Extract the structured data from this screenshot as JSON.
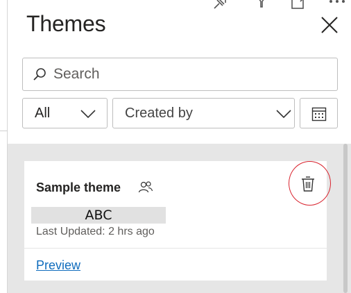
{
  "panel": {
    "title": "Themes"
  },
  "search": {
    "placeholder": "Search"
  },
  "filters": {
    "type_selected": "All",
    "creator_selected": "Created by"
  },
  "theme_card": {
    "name": "Sample theme",
    "sample_text": "ABC",
    "last_updated": "Last Updated: 2 hrs ago",
    "preview_label": "Preview"
  },
  "colors": {
    "highlight_circle": "#d9232e",
    "link": "#0f6cbd",
    "list_background": "#e6e6e6"
  },
  "icons": [
    "pin-icon",
    "filter-icon",
    "expand-icon",
    "more-icon",
    "close-icon",
    "search-icon",
    "chevron-down-icon",
    "calendar-icon",
    "shared-users-icon",
    "trash-icon"
  ]
}
